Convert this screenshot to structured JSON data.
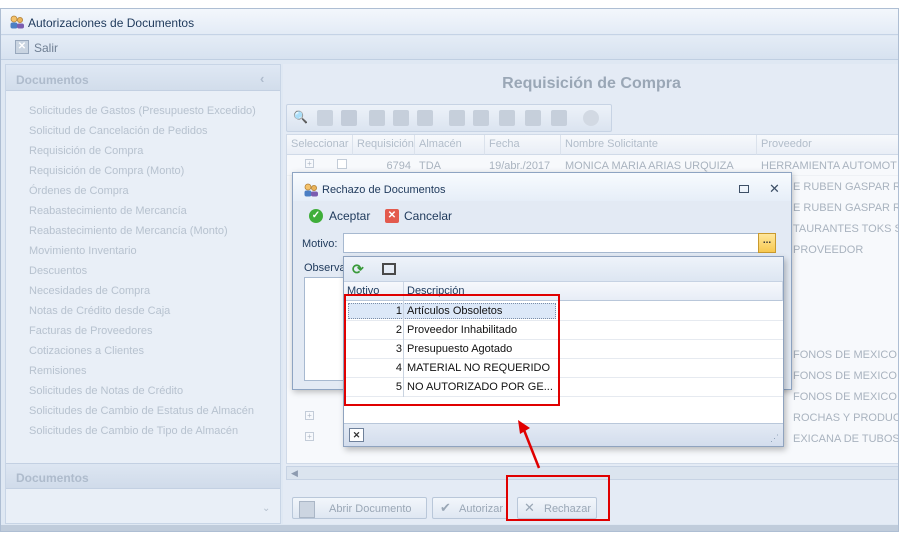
{
  "window": {
    "title": "Autorizaciones de Documentos"
  },
  "menu": {
    "salir_label": "Salir"
  },
  "sidebar": {
    "header": "Documentos",
    "collapse_glyph": "‹",
    "items": [
      "Solicitudes de Gastos (Presupuesto Excedido)",
      "Solicitud de Cancelación de Pedidos",
      "Requisición de Compra",
      "Requisición de Compra (Monto)",
      "Órdenes de Compra",
      "Reabastecimiento de Mercancía",
      "Reabastecimiento de Mercancía (Monto)",
      "Movimiento Inventario",
      "Descuentos",
      "Necesidades de Compra",
      "Notas de Crédito desde Caja",
      "Facturas de Proveedores",
      "Cotizaciones a Clientes",
      "Remisiones",
      "Solicitudes de Notas de Crédito",
      "Solicitudes de Cambio de Estatus de Almacén",
      "Solicitudes de Cambio de Tipo de Almacén"
    ],
    "footer": "Documentos"
  },
  "main": {
    "title": "Requisición de Compra",
    "columns": [
      "Seleccionar",
      "Requisición",
      "Almacén",
      "Fecha",
      "Nombre Solicitante",
      "Proveedor"
    ],
    "first_row": {
      "requisicion": "6794",
      "almacen": "TDA",
      "fecha": "19/abr./2017",
      "solicitante": "MONICA MARIA ARIAS URQUIZA",
      "proveedor": "HERRAMIENTA AUTOMOT"
    },
    "proveedor_visible": [
      "E RUBEN GASPAR ROJ",
      "E RUBEN GASPAR ROJ",
      "TAURANTES TOKS S.A",
      "PROVEEDOR",
      "FONOS DE MEXICO S",
      "FONOS DE MEXICO S",
      "FONOS DE MEXICO S",
      "ROCHAS Y PRODUCTOS",
      "EXICANA DE TUBOS Y VA"
    ],
    "buttons": {
      "abrir": "Abrir Documento",
      "autorizar": "Autorizar",
      "rechazar": "Rechazar"
    }
  },
  "dialog": {
    "title": "Rechazo de Documentos",
    "aceptar": "Aceptar",
    "cancelar": "Cancelar",
    "motivo_label": "Motivo:",
    "motivo_value": "",
    "observaciones_label": "Observa",
    "ellipsis": "..."
  },
  "popup": {
    "col_motivo": "Motivo",
    "col_descripcion": "Descripción",
    "rows": [
      {
        "motivo": "1",
        "descripcion": "Artículos Obsoletos"
      },
      {
        "motivo": "2",
        "descripcion": "Proveedor Inhabilitado"
      },
      {
        "motivo": "3",
        "descripcion": "Presupuesto Agotado"
      },
      {
        "motivo": "4",
        "descripcion": "MATERIAL NO REQUERIDO"
      },
      {
        "motivo": "5",
        "descripcion": "NO AUTORIZADO POR GE..."
      }
    ]
  },
  "colors": {
    "highlight": "#e00000",
    "selected_row": "#dce8f8",
    "title_text": "#1e395b"
  }
}
